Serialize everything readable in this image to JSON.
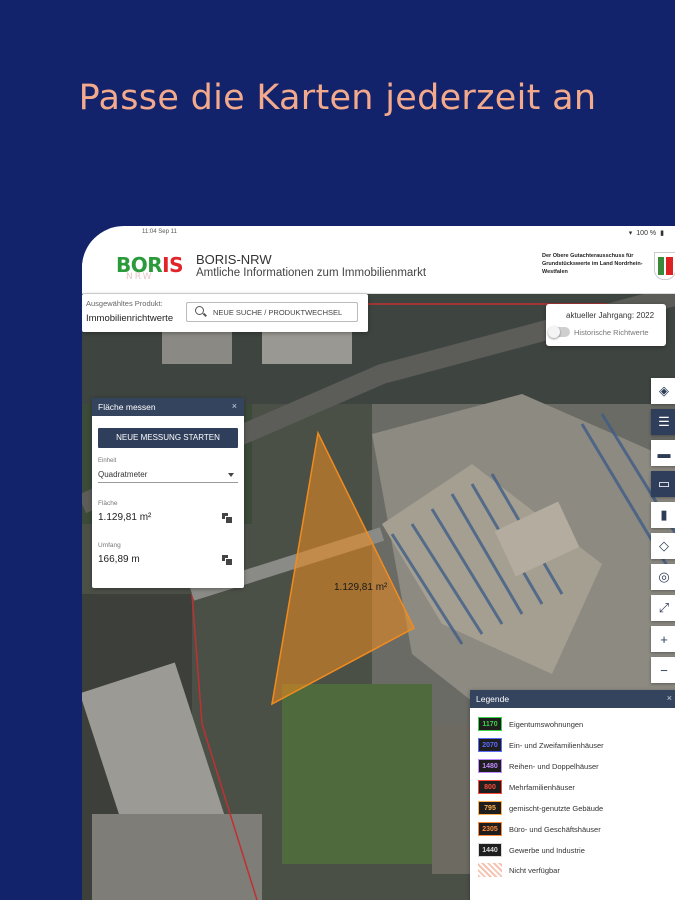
{
  "headline": "Passe die Karten jederzeit an",
  "status": {
    "carrier": "11:04 Sep 11",
    "battery": "100 %"
  },
  "app": {
    "logo_primary": "BOR",
    "logo_accent": "IS",
    "logo_sub": "NRW",
    "title": "BORIS-NRW",
    "subtitle": "Amtliche Informationen zum Immobilienmarkt",
    "org": "Der Obere Gutachterausschuss für Grundstückswerte im Land Nordrhein-Westfalen"
  },
  "product": {
    "label": "Ausgewähltes Produkt:",
    "value": "Immobilienrichtwerte",
    "search_button": "NEUE SUCHE / PRODUKTWECHSEL"
  },
  "year": {
    "label": "aktueller Jahrgang: 2022",
    "toggle": "Historische Richtwerte"
  },
  "measure": {
    "title": "Fläche messen",
    "start_button": "NEUE MESSUNG STARTEN",
    "unit_label": "Einheit",
    "unit_value": "Quadratmeter",
    "area_label": "Fläche",
    "area_value": "1.129,81 m²",
    "perimeter_label": "Umfang",
    "perimeter_value": "166,89 m"
  },
  "map_label": "1.129,81 m²",
  "toolbar": [
    "layers-icon",
    "list-icon",
    "ruler-icon",
    "folder-icon",
    "bookmark-icon",
    "locate-icon",
    "globe-icon",
    "fullscreen-icon",
    "zoom-in-icon",
    "zoom-out-icon"
  ],
  "legend": {
    "title": "Legende",
    "items": [
      {
        "value": "1170",
        "label": "Eigentumswohnungen",
        "color": "#3bd34a"
      },
      {
        "value": "2070",
        "label": "Ein- und Zweifamilienhäuser",
        "color": "#5b6cff"
      },
      {
        "value": "1480",
        "label": "Reihen- und Doppelhäuser",
        "color": "#c08cff"
      },
      {
        "value": "800",
        "label": "Mehrfamilienhäuser",
        "color": "#ff4a3a"
      },
      {
        "value": "795",
        "label": "gemischt-genutzte Gebäude",
        "color": "#ffb04a"
      },
      {
        "value": "2305",
        "label": "Büro- und Geschäftshäuser",
        "color": "#ff8a3a"
      },
      {
        "value": "1440",
        "label": "Gewerbe und Industrie",
        "color": "#d9d9d9"
      }
    ],
    "unavailable": "Nicht verfügbar"
  },
  "colors": {
    "background": "#13236b",
    "headline": "#f3a98c",
    "panel_header": "#34445e",
    "measure_fill": "#f08c1e"
  }
}
